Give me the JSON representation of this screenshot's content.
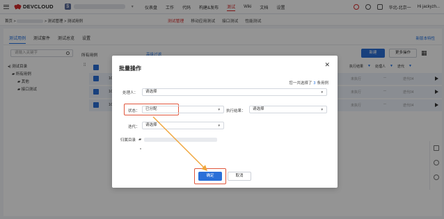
{
  "topbar": {
    "logo_text": "DEVCLOUD",
    "project_icon_text": "$",
    "nav": [
      "仪表盘",
      "工作",
      "代码",
      "构建&发布",
      "测试",
      "Wiki",
      "文档",
      "设置"
    ],
    "active_nav": "测试",
    "region": "华北-北京一",
    "user": "Hi jackyzh..."
  },
  "breadcrumb": {
    "home": "首页 >",
    "rest": "> 测试管理 > 测试用例"
  },
  "subnav": [
    "测试管理",
    "移动应用测试",
    "接口测试",
    "性能测试"
  ],
  "tabs": [
    "测试用例",
    "测试套件",
    "测试总览",
    "设置"
  ],
  "new_features": "新版本特性",
  "search": {
    "placeholder": "请输入关键字"
  },
  "filter_label": "所有用例",
  "advanced_filter": "高级过滤",
  "buttons": {
    "new": "新建",
    "more": "更多操作"
  },
  "tree": {
    "root": "测试目录",
    "all": "所有用例",
    "items": [
      "其他",
      "接口测试"
    ]
  },
  "table": {
    "header_cols": [
      "执行结果",
      "处理人",
      "迭代"
    ],
    "rows": [
      {
        "id": "1C",
        "status": "未执行",
        "assignee": "--",
        "iteration": "迭代04"
      },
      {
        "id": "1C",
        "status": "未执行",
        "assignee": "--",
        "iteration": "迭代04"
      },
      {
        "id": "1C",
        "status": "未执行",
        "assignee": "--",
        "iteration": "迭代04"
      }
    ]
  },
  "modal": {
    "title": "批量操作",
    "count_prefix": "您一共选择了",
    "count_value": "3",
    "count_suffix": "条用例",
    "fields": {
      "assignee_label": "处理人：",
      "assignee_value": "请选择",
      "status_label": "状态：",
      "status_value": "已分配",
      "result_label": "执行结果：",
      "result_value": "请选择",
      "iteration_label": "迭代：",
      "iteration_value": "请选择",
      "dir_label": "归属目录"
    },
    "ok": "确定",
    "cancel": "取消"
  },
  "colors": {
    "accent_red": "#d62a2a",
    "primary_blue": "#2a6fd8",
    "highlight": "#e0563c"
  }
}
